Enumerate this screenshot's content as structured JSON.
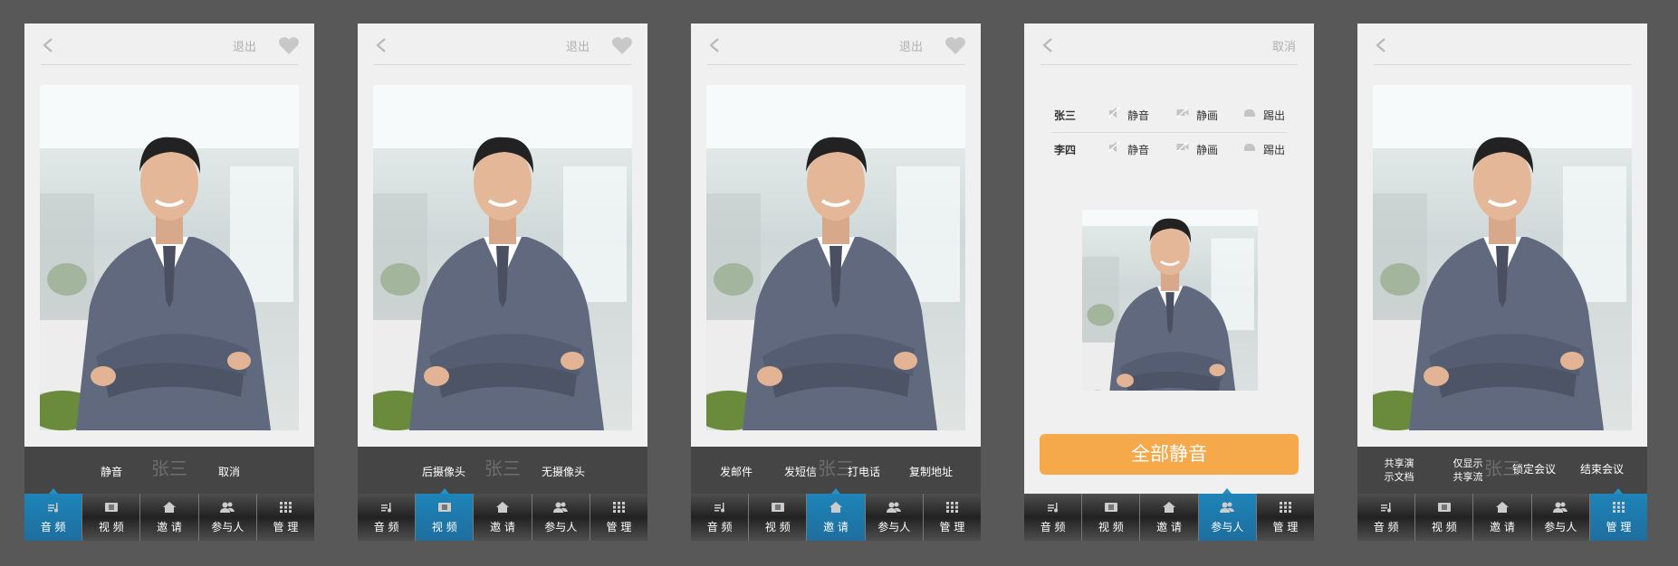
{
  "colors": {
    "background": "#585858",
    "accent": "#1e84b8",
    "mute_all_button": "#f6a94b"
  },
  "icons": {
    "back": "back-icon",
    "heart": "heart-icon",
    "audio": "music-note-icon",
    "video": "video-icon",
    "invite": "home-icon",
    "participants": "people-icon",
    "manage": "grid-icon",
    "mic_off": "mic-off-icon",
    "camera_off": "camera-off-icon",
    "kick": "kick-icon"
  },
  "tabs": [
    "音 频",
    "视 频",
    "邀 请",
    "参与人",
    "管 理"
  ],
  "screens": [
    {
      "exit_label": "退出",
      "watermark": "张三",
      "actions": [
        "静音",
        "取消"
      ],
      "active_tab": 0
    },
    {
      "exit_label": "退出",
      "watermark": "张三",
      "actions": [
        "后摄像头",
        "无摄像头"
      ],
      "active_tab": 1
    },
    {
      "exit_label": "退出",
      "watermark": "张三",
      "actions": [
        "发邮件",
        "发短信",
        "打电话",
        "复制地址"
      ],
      "active_tab": 2
    },
    {
      "cancel_label": "取消",
      "participants": [
        {
          "name": "张三",
          "mute": "静音",
          "video": "静画",
          "kick": "踢出"
        },
        {
          "name": "李四",
          "mute": "静音",
          "video": "静画",
          "kick": "踢出"
        }
      ],
      "mute_all": "全部静音",
      "active_tab": 3
    },
    {
      "watermark": "张三",
      "actions": [
        {
          "line1": "共享演",
          "line2": "示文档"
        },
        {
          "line1": "仅显示",
          "line2": "共享流"
        },
        "锁定会议",
        "结束会议"
      ],
      "active_tab": 4
    }
  ]
}
